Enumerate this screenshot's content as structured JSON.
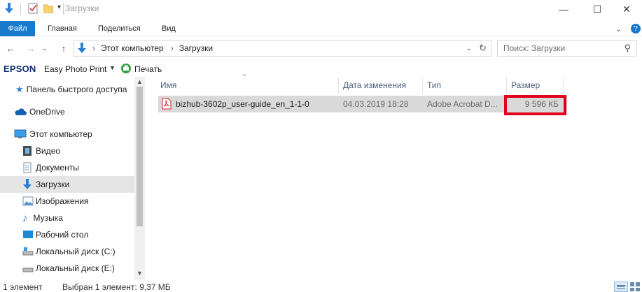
{
  "window": {
    "title": "Загрузки",
    "min_glyph": "—",
    "max_glyph": "☐",
    "close_glyph": "✕"
  },
  "ribbon": {
    "tabs": [
      "Файл",
      "Главная",
      "Поделиться",
      "Вид"
    ],
    "expand_glyph": "⌄",
    "help_glyph": "?"
  },
  "nav_glyphs": {
    "back": "←",
    "forward": "→",
    "recent": "⌄",
    "up": "↑",
    "dropdown": "⌄",
    "refresh": "↻",
    "search": "⚲"
  },
  "address": {
    "crumbs": [
      "Этот компьютер",
      "Загрузки"
    ],
    "separator": "›"
  },
  "search": {
    "placeholder": "Поиск: Загрузки"
  },
  "epson_bar": {
    "brand": "EPSON",
    "app_label": "Easy Photo Print",
    "print_label": "Печать"
  },
  "sidebar": {
    "items": [
      {
        "label": "Панель быстрого доступа",
        "icon": "star-icon"
      },
      {
        "label": "OneDrive",
        "icon": "cloud-icon"
      },
      {
        "label": "Этот компьютер",
        "icon": "computer-icon"
      },
      {
        "label": "Видео",
        "icon": "video-icon"
      },
      {
        "label": "Документы",
        "icon": "documents-icon"
      },
      {
        "label": "Загрузки",
        "icon": "download-icon",
        "selected": true
      },
      {
        "label": "Изображения",
        "icon": "pictures-icon"
      },
      {
        "label": "Музыка",
        "icon": "music-icon"
      },
      {
        "label": "Рабочий стол",
        "icon": "desktop-icon"
      },
      {
        "label": "Локальный диск (C:)",
        "icon": "drive-icon"
      },
      {
        "label": "Локальный диск (E:)",
        "icon": "drive-icon"
      }
    ]
  },
  "columns": [
    "Имя",
    "Дата изменения",
    "Тип",
    "Размер"
  ],
  "files": [
    {
      "name": "bizhub-3602p_user-guide_en_1-1-0",
      "modified": "04.03.2019 18:28",
      "type": "Adobe Acrobat D...",
      "size": "9 596 КБ"
    }
  ],
  "status": {
    "count": "1 элемент",
    "selection": "Выбран 1 элемент: 9,37 МБ"
  },
  "colors": {
    "accent": "#1979ca",
    "highlight": "#e3001b",
    "selection": "#d9d9d9"
  }
}
